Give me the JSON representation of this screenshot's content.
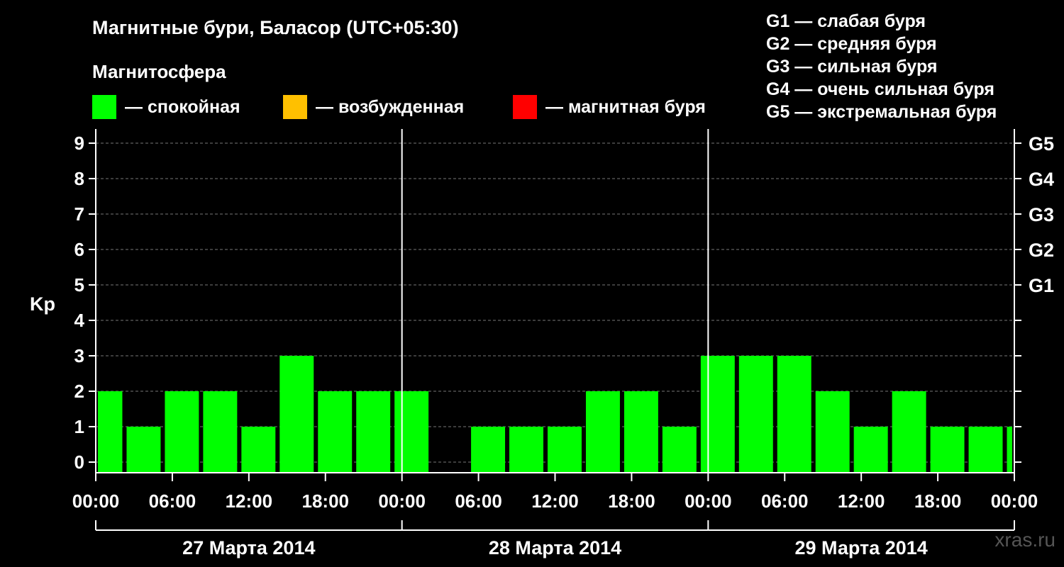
{
  "header": {
    "title": "Магнитные бури, Баласор (UTC+05:30)",
    "subtitle": "Магнитосфера"
  },
  "legend": [
    {
      "label": "— спокойная",
      "color": "#00ff00"
    },
    {
      "label": "— возбужденная",
      "color": "#ffc000"
    },
    {
      "label": "— магнитная буря",
      "color": "#ff0000"
    }
  ],
  "storm_scale": [
    "G1 — слабая буря",
    "G2 — средняя буря",
    "G3 — сильная буря",
    "G4 — очень сильная буря",
    "G5 — экстремальная буря"
  ],
  "watermark": "xras.ru",
  "chart_data": {
    "type": "bar",
    "ylabel": "Kp",
    "ylim": [
      0,
      9
    ],
    "yticks": [
      "0",
      "1",
      "2",
      "3",
      "4",
      "5",
      "6",
      "7",
      "8",
      "9"
    ],
    "g_levels": [
      {
        "label": "G1",
        "kp": 5
      },
      {
        "label": "G2",
        "kp": 6
      },
      {
        "label": "G3",
        "kp": 7
      },
      {
        "label": "G4",
        "kp": 8
      },
      {
        "label": "G5",
        "kp": 9
      }
    ],
    "xticks": [
      "00:00",
      "06:00",
      "12:00",
      "18:00",
      "00:00",
      "06:00",
      "12:00",
      "18:00",
      "00:00",
      "06:00",
      "12:00",
      "18:00",
      "00:00"
    ],
    "days": [
      "27 Марта 2014",
      "28 Марта 2014",
      "29 Марта 2014"
    ],
    "bar_color": "#00ff00",
    "bars": [
      {
        "start_hour": 0,
        "end_hour": 2.25,
        "kp": 2
      },
      {
        "start_hour": 2.25,
        "end_hour": 5.25,
        "kp": 1
      },
      {
        "start_hour": 5.25,
        "end_hour": 8.25,
        "kp": 2
      },
      {
        "start_hour": 8.25,
        "end_hour": 11.25,
        "kp": 2
      },
      {
        "start_hour": 11.25,
        "end_hour": 14.25,
        "kp": 1
      },
      {
        "start_hour": 14.25,
        "end_hour": 17.25,
        "kp": 3
      },
      {
        "start_hour": 17.25,
        "end_hour": 20.25,
        "kp": 2
      },
      {
        "start_hour": 20.25,
        "end_hour": 23.25,
        "kp": 2
      },
      {
        "start_hour": 23.25,
        "end_hour": 26.25,
        "kp": 2
      },
      {
        "start_hour": 26.25,
        "end_hour": 29.25,
        "kp": 0
      },
      {
        "start_hour": 29.25,
        "end_hour": 32.25,
        "kp": 1
      },
      {
        "start_hour": 32.25,
        "end_hour": 35.25,
        "kp": 1
      },
      {
        "start_hour": 35.25,
        "end_hour": 38.25,
        "kp": 1
      },
      {
        "start_hour": 38.25,
        "end_hour": 41.25,
        "kp": 2
      },
      {
        "start_hour": 41.25,
        "end_hour": 44.25,
        "kp": 2
      },
      {
        "start_hour": 44.25,
        "end_hour": 47.25,
        "kp": 1
      },
      {
        "start_hour": 47.25,
        "end_hour": 50.25,
        "kp": 3
      },
      {
        "start_hour": 50.25,
        "end_hour": 53.25,
        "kp": 3
      },
      {
        "start_hour": 53.25,
        "end_hour": 56.25,
        "kp": 3
      },
      {
        "start_hour": 56.25,
        "end_hour": 59.25,
        "kp": 2
      },
      {
        "start_hour": 59.25,
        "end_hour": 62.25,
        "kp": 1
      },
      {
        "start_hour": 62.25,
        "end_hour": 65.25,
        "kp": 2
      },
      {
        "start_hour": 65.25,
        "end_hour": 68.25,
        "kp": 1
      },
      {
        "start_hour": 68.25,
        "end_hour": 71.25,
        "kp": 1
      },
      {
        "start_hour": 71.25,
        "end_hour": 72,
        "kp": 1
      }
    ]
  }
}
